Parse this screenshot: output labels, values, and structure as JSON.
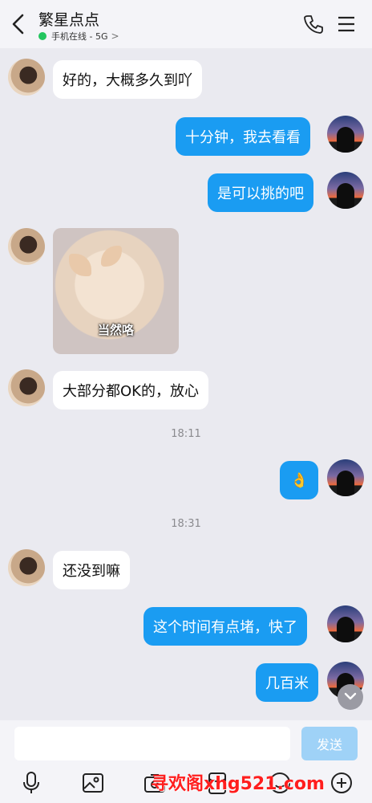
{
  "header": {
    "title": "繁星点点",
    "status_text": "手机在线 - 5G",
    "status_chevron": ">"
  },
  "messages": [
    {
      "side": "in",
      "text": "好的，大概多久到吖"
    },
    {
      "side": "out",
      "text": "十分钟，我去看看"
    },
    {
      "side": "out",
      "text": "是可以挑的吧"
    },
    {
      "side": "in",
      "sticker_caption": "当然咯"
    },
    {
      "side": "in",
      "text": "大部分都OK的，放心"
    },
    {
      "time": "18:11"
    },
    {
      "side": "out",
      "text": "👌"
    },
    {
      "time": "18:31"
    },
    {
      "side": "in",
      "text": "还没到嘛"
    },
    {
      "side": "out",
      "text": "这个时间有点堵，快了"
    },
    {
      "side": "out",
      "text": "几百米"
    }
  ],
  "composer": {
    "input_value": "",
    "send_label": "发送"
  },
  "toolbar": {
    "icons": [
      "microphone-icon",
      "image-icon",
      "camera-icon",
      "red-packet-icon",
      "emoji-icon",
      "plus-icon"
    ]
  },
  "watermark": "寻欢阁xhg521.com",
  "colors": {
    "outgoing_bubble": "#1a9cf2",
    "incoming_bubble": "#ffffff",
    "online_dot": "#22c55e",
    "background": "#eaeaf0"
  }
}
